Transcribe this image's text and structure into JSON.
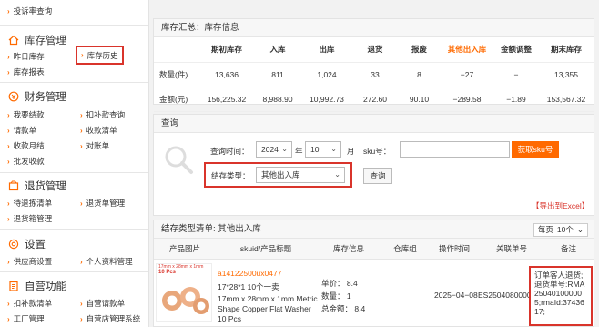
{
  "sidebar": {
    "top_item": "投诉率查询",
    "sections": [
      {
        "title": "库存管理",
        "icon": "home-icon",
        "items": [
          [
            "昨日库存",
            "库存历史"
          ],
          [
            "库存报表",
            ""
          ]
        ]
      },
      {
        "title": "财务管理",
        "icon": "finance-icon",
        "items": [
          [
            "我要结款",
            "扣补款查询"
          ],
          [
            "请款单",
            "收款清单"
          ],
          [
            "收款月结",
            "对账单"
          ],
          [
            "批发收款",
            ""
          ]
        ]
      },
      {
        "title": "退货管理",
        "icon": "return-icon",
        "items": [
          [
            "待退拣清单",
            "退货单管理"
          ],
          [
            "退货箱管理",
            ""
          ]
        ]
      },
      {
        "title": "设置",
        "icon": "gear-icon",
        "items": [
          [
            "供应商设置",
            "个人资料管理"
          ]
        ]
      },
      {
        "title": "自营功能",
        "icon": "document-icon",
        "items": [
          [
            "扣补款清单",
            "自营请款单"
          ],
          [
            "工厂管理",
            "自营店管理系统"
          ]
        ]
      }
    ]
  },
  "summary": {
    "title": "库存汇总：库存信息",
    "headers": [
      "",
      "期初库存",
      "入库",
      "出库",
      "退货",
      "报废",
      "其他出入库",
      "金额调整",
      "期末库存"
    ],
    "rows": [
      [
        "数量(件)",
        "13,636",
        "811",
        "1,024",
        "33",
        "8",
        "−27",
        "−",
        "13,355"
      ],
      [
        "金额(元)",
        "156,225.32",
        "8,988.90",
        "10,992.73",
        "272.60",
        "90.10",
        "−289.58",
        "−1.89",
        "153,567.32"
      ]
    ]
  },
  "query": {
    "title": "查询",
    "time_label": "查询时间：",
    "year": "2024",
    "year_unit": "年",
    "month": "10",
    "month_unit": "月",
    "sku_label": "sku号：",
    "sku_placeholder": "",
    "get_sku_button": "获取sku号",
    "type_label": "结存类型：",
    "type_value": "其他出入库",
    "query_button": "查询",
    "export_link": "【导出到Excel】"
  },
  "results": {
    "title": "结存类型清单: 其他出入库",
    "per_page_prefix": "每页",
    "per_page_value": "10个",
    "headers": [
      "产品图片",
      "skuid/产品标题",
      "库存信息",
      "仓库组",
      "操作时间",
      "关联单号",
      "备注"
    ],
    "row": {
      "image_caption": "17mm x 28mm x 1mm",
      "image_badge": "10 Pcs",
      "sku": "a14122500ux0477",
      "title_line1": "17*28*1 10个一卖",
      "title_line2": "17mm x 28mm x 1mm Metric Shape Copper Flat Washer 10 Pcs",
      "unit_price": "单价： 8.4",
      "quantity": "数量： 1",
      "total": "总金额： 8.4",
      "warehouse": "",
      "time": "2025−04−08",
      "related_no": "ES2504080000",
      "remark": "订单客人退货;退货单号:RMA250401000005;rmaId:3743617;"
    }
  },
  "colors": {
    "accent": "#ff6a00",
    "highlight": "#d9342b"
  }
}
